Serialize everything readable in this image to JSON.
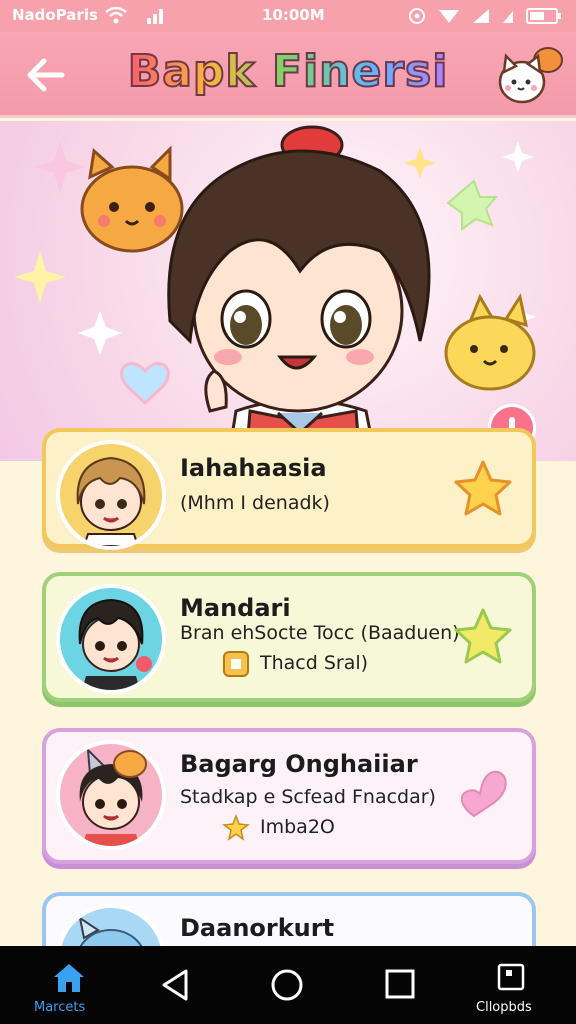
{
  "status_bar": {
    "carrier": "NadoParis",
    "time": "10:00M"
  },
  "header": {
    "title": "Bapk Finersi",
    "back_icon": "back-arrow-icon",
    "mascot_icon": "cat-mascot-icon"
  },
  "colors": {
    "header": "#f7a1ad",
    "accent": "#f6738b"
  },
  "cards": [
    {
      "name": "Iahahaasia",
      "line1": "(Mhm I denadk)",
      "icon": "star-icon"
    },
    {
      "name": "Mandari",
      "line1": "Bran ehSocte Tocc (Baaduen)",
      "line2": "Thacd Sral)",
      "icon": "star-icon"
    },
    {
      "name": "Bagarg Onghaiiar",
      "line1": "Stadkap e Scfead Fnacdar)",
      "line2": "Imba2O",
      "icon": "heart-icon"
    },
    {
      "name": "Daanorkurt"
    }
  ],
  "nav": {
    "home_label": "Marcets",
    "right_label": "Cllopbds"
  }
}
